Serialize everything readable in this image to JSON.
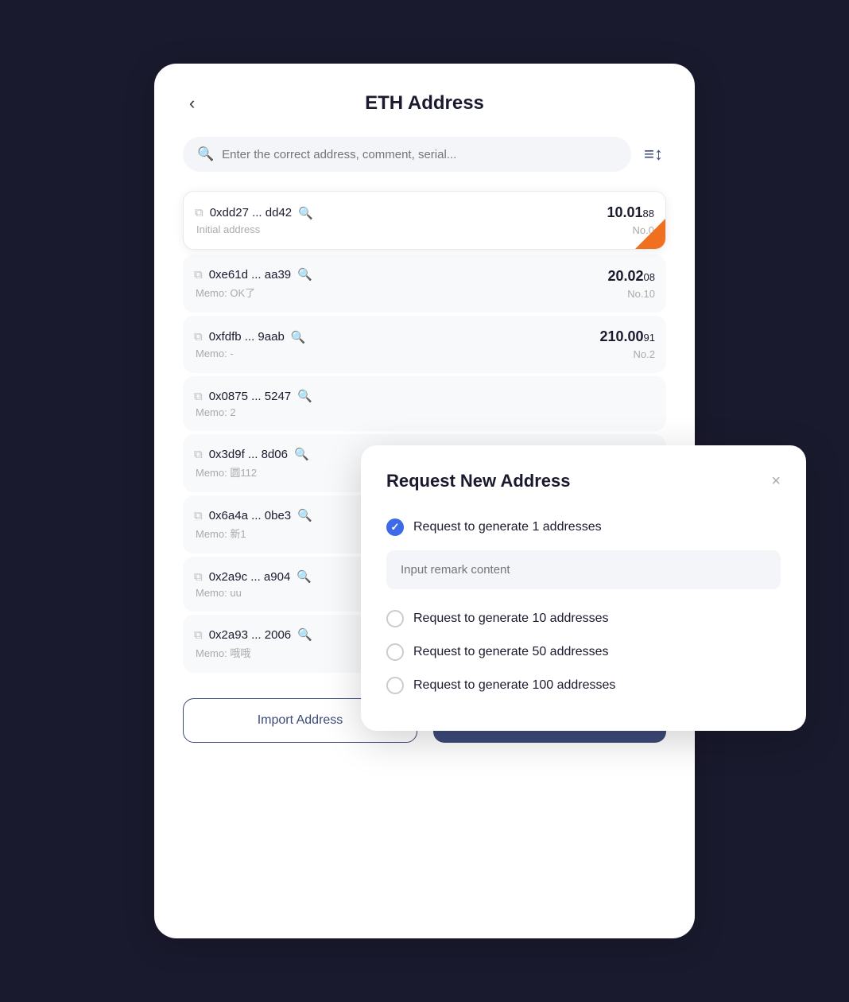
{
  "header": {
    "back_label": "‹",
    "title": "ETH Address"
  },
  "search": {
    "placeholder": "Enter the correct address, comment, serial..."
  },
  "filter_icon": "≡↕",
  "addresses": [
    {
      "hash": "0xdd27 ... dd42",
      "memo": "Initial address",
      "amount_main": "10.01",
      "amount_small": "88",
      "no": "No.0",
      "active": true
    },
    {
      "hash": "0xe61d ... aa39",
      "memo": "Memo: OK了",
      "amount_main": "20.02",
      "amount_small": "08",
      "no": "No.10",
      "active": false
    },
    {
      "hash": "0xfdfb ... 9aab",
      "memo": "Memo: -",
      "amount_main": "210.00",
      "amount_small": "91",
      "no": "No.2",
      "active": false
    },
    {
      "hash": "0x0875 ... 5247",
      "memo": "Memo: 2",
      "amount_main": "",
      "amount_small": "",
      "no": "",
      "active": false
    },
    {
      "hash": "0x3d9f ... 8d06",
      "memo": "Memo: 圆112",
      "amount_main": "",
      "amount_small": "",
      "no": "",
      "active": false
    },
    {
      "hash": "0x6a4a ... 0be3",
      "memo": "Memo: 新1",
      "amount_main": "",
      "amount_small": "",
      "no": "",
      "active": false
    },
    {
      "hash": "0x2a9c ... a904",
      "memo": "Memo: uu",
      "amount_main": "",
      "amount_small": "",
      "no": "",
      "active": false
    },
    {
      "hash": "0x2a93 ... 2006",
      "memo": "Memo: 哦哦",
      "amount_main": "",
      "amount_small": "",
      "no": "",
      "active": false
    }
  ],
  "buttons": {
    "import": "Import Address",
    "request": "Request New Address"
  },
  "modal": {
    "title": "Request New Address",
    "close": "×",
    "options": [
      {
        "label": "Request to generate 1 addresses",
        "checked": true
      },
      {
        "label": "Request to generate 10 addresses",
        "checked": false
      },
      {
        "label": "Request to generate 50 addresses",
        "checked": false
      },
      {
        "label": "Request to generate 100 addresses",
        "checked": false
      }
    ],
    "remark_placeholder": "Input remark content"
  }
}
